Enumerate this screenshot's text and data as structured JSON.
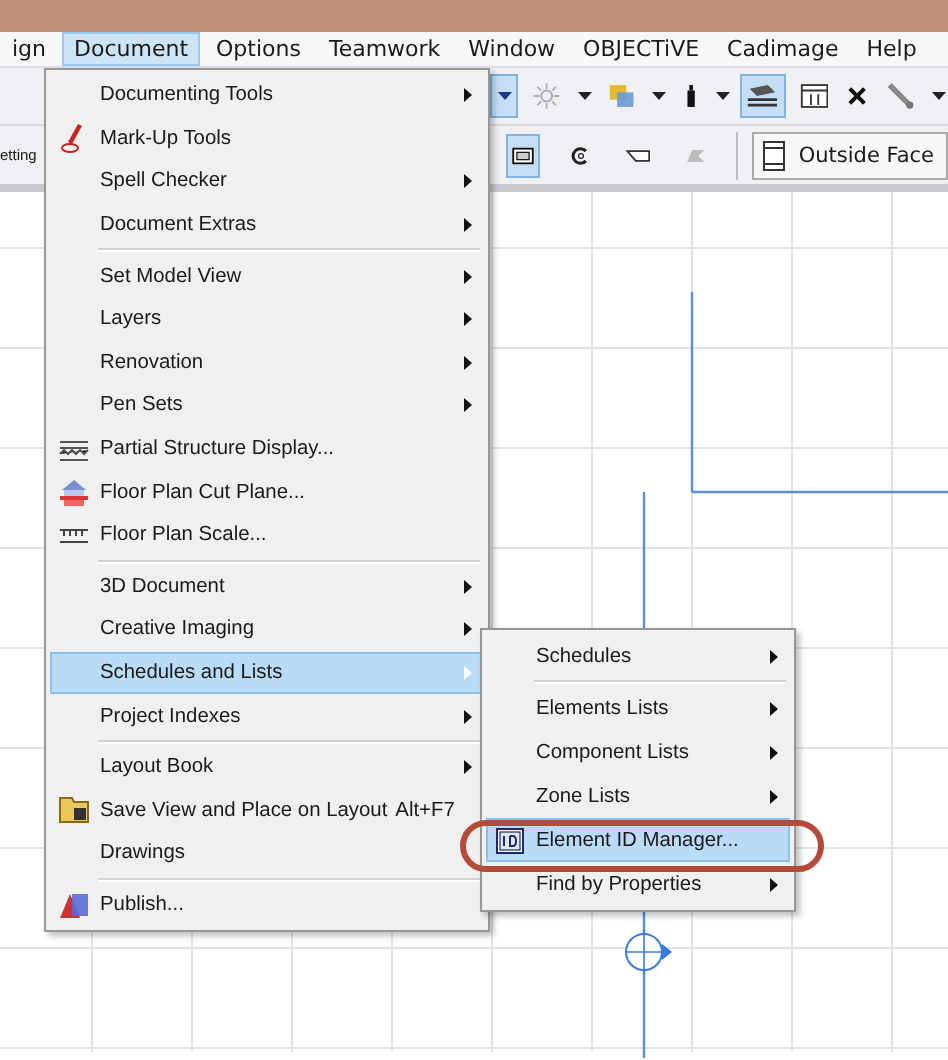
{
  "menubar": {
    "items": [
      {
        "label": "ign",
        "selected": false
      },
      {
        "label": "Document",
        "selected": true
      },
      {
        "label": "Options",
        "selected": false
      },
      {
        "label": "Teamwork",
        "selected": false
      },
      {
        "label": "Window",
        "selected": false
      },
      {
        "label": "OBJECTiVE",
        "selected": false
      },
      {
        "label": "Cadimage",
        "selected": false
      },
      {
        "label": "Help",
        "selected": false
      }
    ]
  },
  "toolbar": {
    "row_1_tools": [
      {
        "pressed": true
      },
      {
        "pressed": false
      },
      {
        "pressed": false
      },
      {
        "pressed": false
      },
      {
        "pressed": true
      },
      {
        "pressed": false
      },
      {
        "pressed": false
      },
      {
        "pressed": false
      }
    ],
    "row_2_label": "etting",
    "row_2_tools": [
      {
        "pressed": true
      },
      {
        "pressed": false
      },
      {
        "pressed": false
      },
      {
        "pressed": false
      }
    ],
    "face_field": {
      "value": "Outside Face"
    }
  },
  "menu": {
    "items": [
      {
        "kind": "item",
        "label": "Documenting Tools",
        "submenu": true,
        "selected": false
      },
      {
        "kind": "item",
        "label": "Mark-Up Tools",
        "submenu": false,
        "selected": false
      },
      {
        "kind": "item",
        "label": "Spell Checker",
        "submenu": true,
        "selected": false
      },
      {
        "kind": "item",
        "label": "Document Extras",
        "submenu": true,
        "selected": false
      },
      {
        "kind": "separator"
      },
      {
        "kind": "item",
        "label": "Set Model View",
        "submenu": true,
        "selected": false
      },
      {
        "kind": "item",
        "label": "Layers",
        "submenu": true,
        "selected": false
      },
      {
        "kind": "item",
        "label": "Renovation",
        "submenu": true,
        "selected": false
      },
      {
        "kind": "item",
        "label": "Pen Sets",
        "submenu": true,
        "selected": false
      },
      {
        "kind": "item",
        "label": "Partial Structure Display...",
        "submenu": false,
        "selected": false
      },
      {
        "kind": "item",
        "label": "Floor Plan Cut Plane...",
        "submenu": false,
        "selected": false
      },
      {
        "kind": "item",
        "label": "Floor Plan Scale...",
        "submenu": false,
        "selected": false
      },
      {
        "kind": "separator"
      },
      {
        "kind": "item",
        "label": "3D Document",
        "submenu": true,
        "selected": false
      },
      {
        "kind": "item",
        "label": "Creative Imaging",
        "submenu": true,
        "selected": false
      },
      {
        "kind": "item",
        "label": "Schedules and Lists",
        "submenu": true,
        "selected": true
      },
      {
        "kind": "item",
        "label": "Project Indexes",
        "submenu": true,
        "selected": false
      },
      {
        "kind": "separator"
      },
      {
        "kind": "item",
        "label": "Layout Book",
        "submenu": true,
        "selected": false
      },
      {
        "kind": "item",
        "label": "Save View and Place on Layout",
        "shortcut": "Alt+F7",
        "submenu": false,
        "selected": false
      },
      {
        "kind": "item",
        "label": "Drawings",
        "submenu": false,
        "selected": false
      },
      {
        "kind": "separator"
      },
      {
        "kind": "item",
        "label": "Publish...",
        "submenu": false,
        "selected": false
      }
    ]
  },
  "submenu": {
    "items": [
      {
        "kind": "item",
        "label": "Schedules",
        "submenu": true,
        "selected": false
      },
      {
        "kind": "separator"
      },
      {
        "kind": "item",
        "label": "Elements Lists",
        "submenu": true,
        "selected": false
      },
      {
        "kind": "item",
        "label": "Component Lists",
        "submenu": true,
        "selected": false
      },
      {
        "kind": "item",
        "label": "Zone Lists",
        "submenu": true,
        "selected": false
      },
      {
        "kind": "item",
        "label": "Element ID Manager...",
        "submenu": false,
        "selected": true
      },
      {
        "kind": "item",
        "label": "Find by Properties",
        "submenu": true,
        "selected": false
      }
    ]
  }
}
